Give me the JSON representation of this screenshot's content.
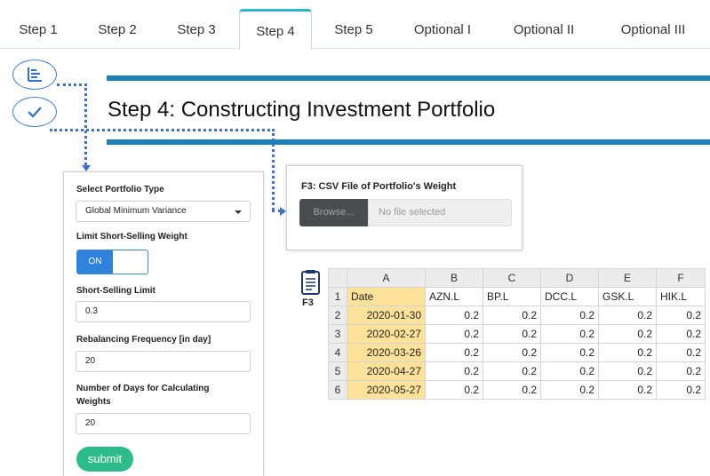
{
  "tabs": [
    {
      "label": "Step 1"
    },
    {
      "label": "Step 2"
    },
    {
      "label": "Step 3"
    },
    {
      "label": "Step 4"
    },
    {
      "label": "Step 5"
    },
    {
      "label": "Optional I"
    },
    {
      "label": "Optional II"
    },
    {
      "label": "Optional III"
    }
  ],
  "active_tab": "Step 4",
  "icons": {
    "top_circle": "bar-chart-icon",
    "bottom_circle": "checkmark-icon",
    "sheet": "spreadsheet-file-icon"
  },
  "page_title": "Step 4: Constructing Investment Portfolio",
  "form": {
    "portfolio_type_label": "Select Portfolio Type",
    "portfolio_type_value": "Global Minimum Variance",
    "limit_short_label": "Limit Short-Selling Weight",
    "toggle_on_label": "ON",
    "short_limit_label": "Short-Selling Limit",
    "short_limit_value": "0.3",
    "rebalancing_label": "Rebalancing Frequency [in day]",
    "rebalancing_value": "20",
    "days_label": "Number of Days for Calculating Weights",
    "days_value": "20",
    "submit_label": "submit"
  },
  "upload": {
    "label": "F3: CSV File of Portfolio's Weight",
    "browse_label": "Browse...",
    "file_placeholder": "No file selected"
  },
  "sheet": {
    "icon_label": "F3",
    "col_headers": [
      "A",
      "B",
      "C",
      "D",
      "E",
      "F"
    ],
    "row_numbers": [
      "1",
      "2",
      "3",
      "4",
      "5",
      "6"
    ],
    "header_row": [
      "Date",
      "AZN.L",
      "BP.L",
      "DCC.L",
      "GSK.L",
      "HIK.L"
    ],
    "rows": [
      [
        "2020-01-30",
        "0.2",
        "0.2",
        "0.2",
        "0.2",
        "0.2"
      ],
      [
        "2020-02-27",
        "0.2",
        "0.2",
        "0.2",
        "0.2",
        "0.2"
      ],
      [
        "2020-03-26",
        "0.2",
        "0.2",
        "0.2",
        "0.2",
        "0.2"
      ],
      [
        "2020-04-27",
        "0.2",
        "0.2",
        "0.2",
        "0.2",
        "0.2"
      ],
      [
        "2020-05-27",
        "0.2",
        "0.2",
        "0.2",
        "0.2",
        "0.2"
      ]
    ]
  },
  "colors": {
    "accent_tab": "#29b9c8",
    "title_rule": "#1b7fb8",
    "toggle": "#2f83dd",
    "submit": "#2dbb89",
    "date_highlight": "#ffe29a"
  }
}
